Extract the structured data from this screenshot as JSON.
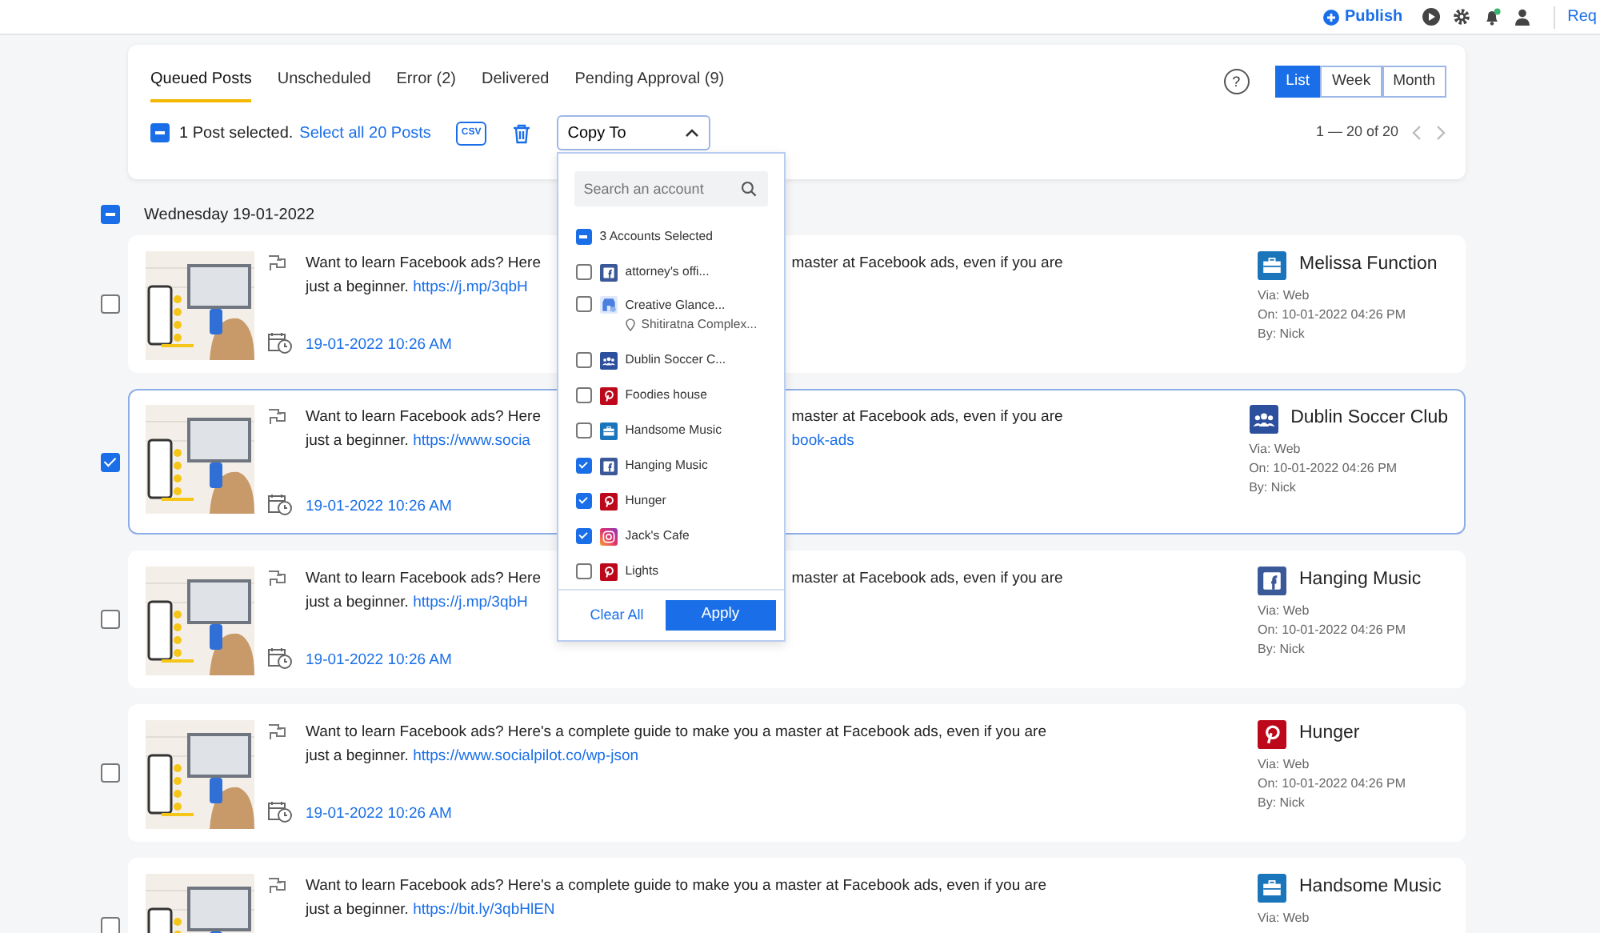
{
  "top_bar": {
    "publish": "Publish",
    "cut_link": "Req"
  },
  "tabs": [
    {
      "label": "Queued Posts",
      "selected": true
    },
    {
      "label": "Unscheduled",
      "selected": false
    },
    {
      "label": "Error (2)",
      "selected": false
    },
    {
      "label": "Delivered",
      "selected": false
    },
    {
      "label": "Pending Approval (9)",
      "selected": false
    }
  ],
  "help": "?",
  "views": [
    {
      "label": "List",
      "selected": true
    },
    {
      "label": "Week",
      "selected": false
    },
    {
      "label": "Month",
      "selected": false
    }
  ],
  "toolbar": {
    "indeterminate": true,
    "selected_text": "1 Post selected.",
    "select_all": "Select all 20 Posts",
    "csv": "CSV",
    "copy_to": {
      "label": "Copy To",
      "expanded": true
    }
  },
  "pagination": {
    "range": "1 — 20 of 20"
  },
  "dropdown": {
    "placeholder": "Search an account",
    "summary": {
      "label": "3 Accounts Selected",
      "indeterminate": true
    },
    "accounts": [
      {
        "name": "attorney's offi...",
        "kind": "facebook",
        "checked": false
      },
      {
        "name": "Creative Glance...",
        "kind": "store",
        "checked": false,
        "location": "Shitiratna Complex..."
      },
      {
        "name": "Dublin Soccer C...",
        "kind": "group",
        "checked": false
      },
      {
        "name": "Foodies house",
        "kind": "pinterest",
        "checked": false
      },
      {
        "name": "Handsome Music",
        "kind": "briefcase",
        "checked": false
      },
      {
        "name": "Hanging Music",
        "kind": "facebook",
        "checked": true
      },
      {
        "name": "Hunger",
        "kind": "pinterest",
        "checked": true
      },
      {
        "name": "Jack's Cafe",
        "kind": "instagram",
        "checked": true
      },
      {
        "name": "Lights",
        "kind": "pinterest",
        "checked": false
      }
    ],
    "clear": "Clear All",
    "apply": "Apply"
  },
  "groups": [
    {
      "date": "Wednesday 19-01-2022",
      "indeterminate": true,
      "posts": [
        {
          "selected": false,
          "lines": [
            {
              "left": [
                {
                  "kind": "text",
                  "text": "Want to learn Facebook ads? Here"
                }
              ],
              "right": [
                {
                  "kind": "text",
                  "text": "master at Facebook ads, even if you are"
                }
              ]
            },
            {
              "left": [
                {
                  "kind": "text",
                  "text": "just a beginner. "
                },
                {
                  "kind": "link",
                  "text": "https://j.mp/3qbH"
                }
              ]
            }
          ],
          "time": "19-01-2022 10:26 AM",
          "account": {
            "kind": "briefcase",
            "name": "Melissa Function"
          },
          "meta": [
            "Via: Web",
            "On: 10-01-2022 04:26 PM",
            "By: Nick"
          ]
        },
        {
          "selected": true,
          "lines": [
            {
              "left": [
                {
                  "kind": "text",
                  "text": "Want to learn Facebook ads? Here"
                }
              ],
              "right": [
                {
                  "kind": "text",
                  "text": "master at Facebook ads, even if you are"
                }
              ]
            },
            {
              "left": [
                {
                  "kind": "text",
                  "text": "just a beginner. "
                },
                {
                  "kind": "link",
                  "text": "https://www.socia"
                }
              ],
              "right": [
                {
                  "kind": "link",
                  "text": "book-ads"
                }
              ]
            }
          ],
          "time": "19-01-2022 10:26 AM",
          "account": {
            "kind": "group",
            "name": "Dublin Soccer Club"
          },
          "meta": [
            "Via: Web",
            "On: 10-01-2022 04:26 PM",
            "By: Nick"
          ]
        },
        {
          "selected": false,
          "lines": [
            {
              "left": [
                {
                  "kind": "text",
                  "text": "Want to learn Facebook ads? Here"
                }
              ],
              "right": [
                {
                  "kind": "text",
                  "text": "master at Facebook ads, even if you are"
                }
              ]
            },
            {
              "left": [
                {
                  "kind": "text",
                  "text": "just a beginner. "
                },
                {
                  "kind": "link",
                  "text": "https://j.mp/3qbH"
                }
              ]
            }
          ],
          "time": "19-01-2022 10:26 AM",
          "account": {
            "kind": "facebook",
            "name": "Hanging Music"
          },
          "meta": [
            "Via: Web",
            "On: 10-01-2022 04:26 PM",
            "By: Nick"
          ]
        },
        {
          "selected": false,
          "lines": [
            {
              "left": [
                {
                  "kind": "text",
                  "text": "Want to learn Facebook ads? Here's a complete guide to make you a master at Facebook ads, even if you are"
                }
              ]
            },
            {
              "left": [
                {
                  "kind": "text",
                  "text": "just a beginner. "
                },
                {
                  "kind": "link",
                  "text": "https://www.socialpilot.co/wp-json"
                }
              ]
            }
          ],
          "time": "19-01-2022 10:26 AM",
          "account": {
            "kind": "pinterest",
            "name": "Hunger"
          },
          "meta": [
            "Via: Web",
            "On: 10-01-2022 04:26 PM",
            "By: Nick"
          ]
        },
        {
          "selected": false,
          "lines": [
            {
              "left": [
                {
                  "kind": "text",
                  "text": "Want to learn Facebook ads? Here's a complete guide to make you a master at Facebook ads, even if you are"
                }
              ]
            },
            {
              "left": [
                {
                  "kind": "text",
                  "text": "just a beginner. "
                },
                {
                  "kind": "link",
                  "text": "https://bit.ly/3qbHlEN"
                }
              ]
            }
          ],
          "account": {
            "kind": "briefcase",
            "name": "Handsome Music"
          },
          "meta": [
            "Via: Web"
          ]
        }
      ]
    }
  ]
}
